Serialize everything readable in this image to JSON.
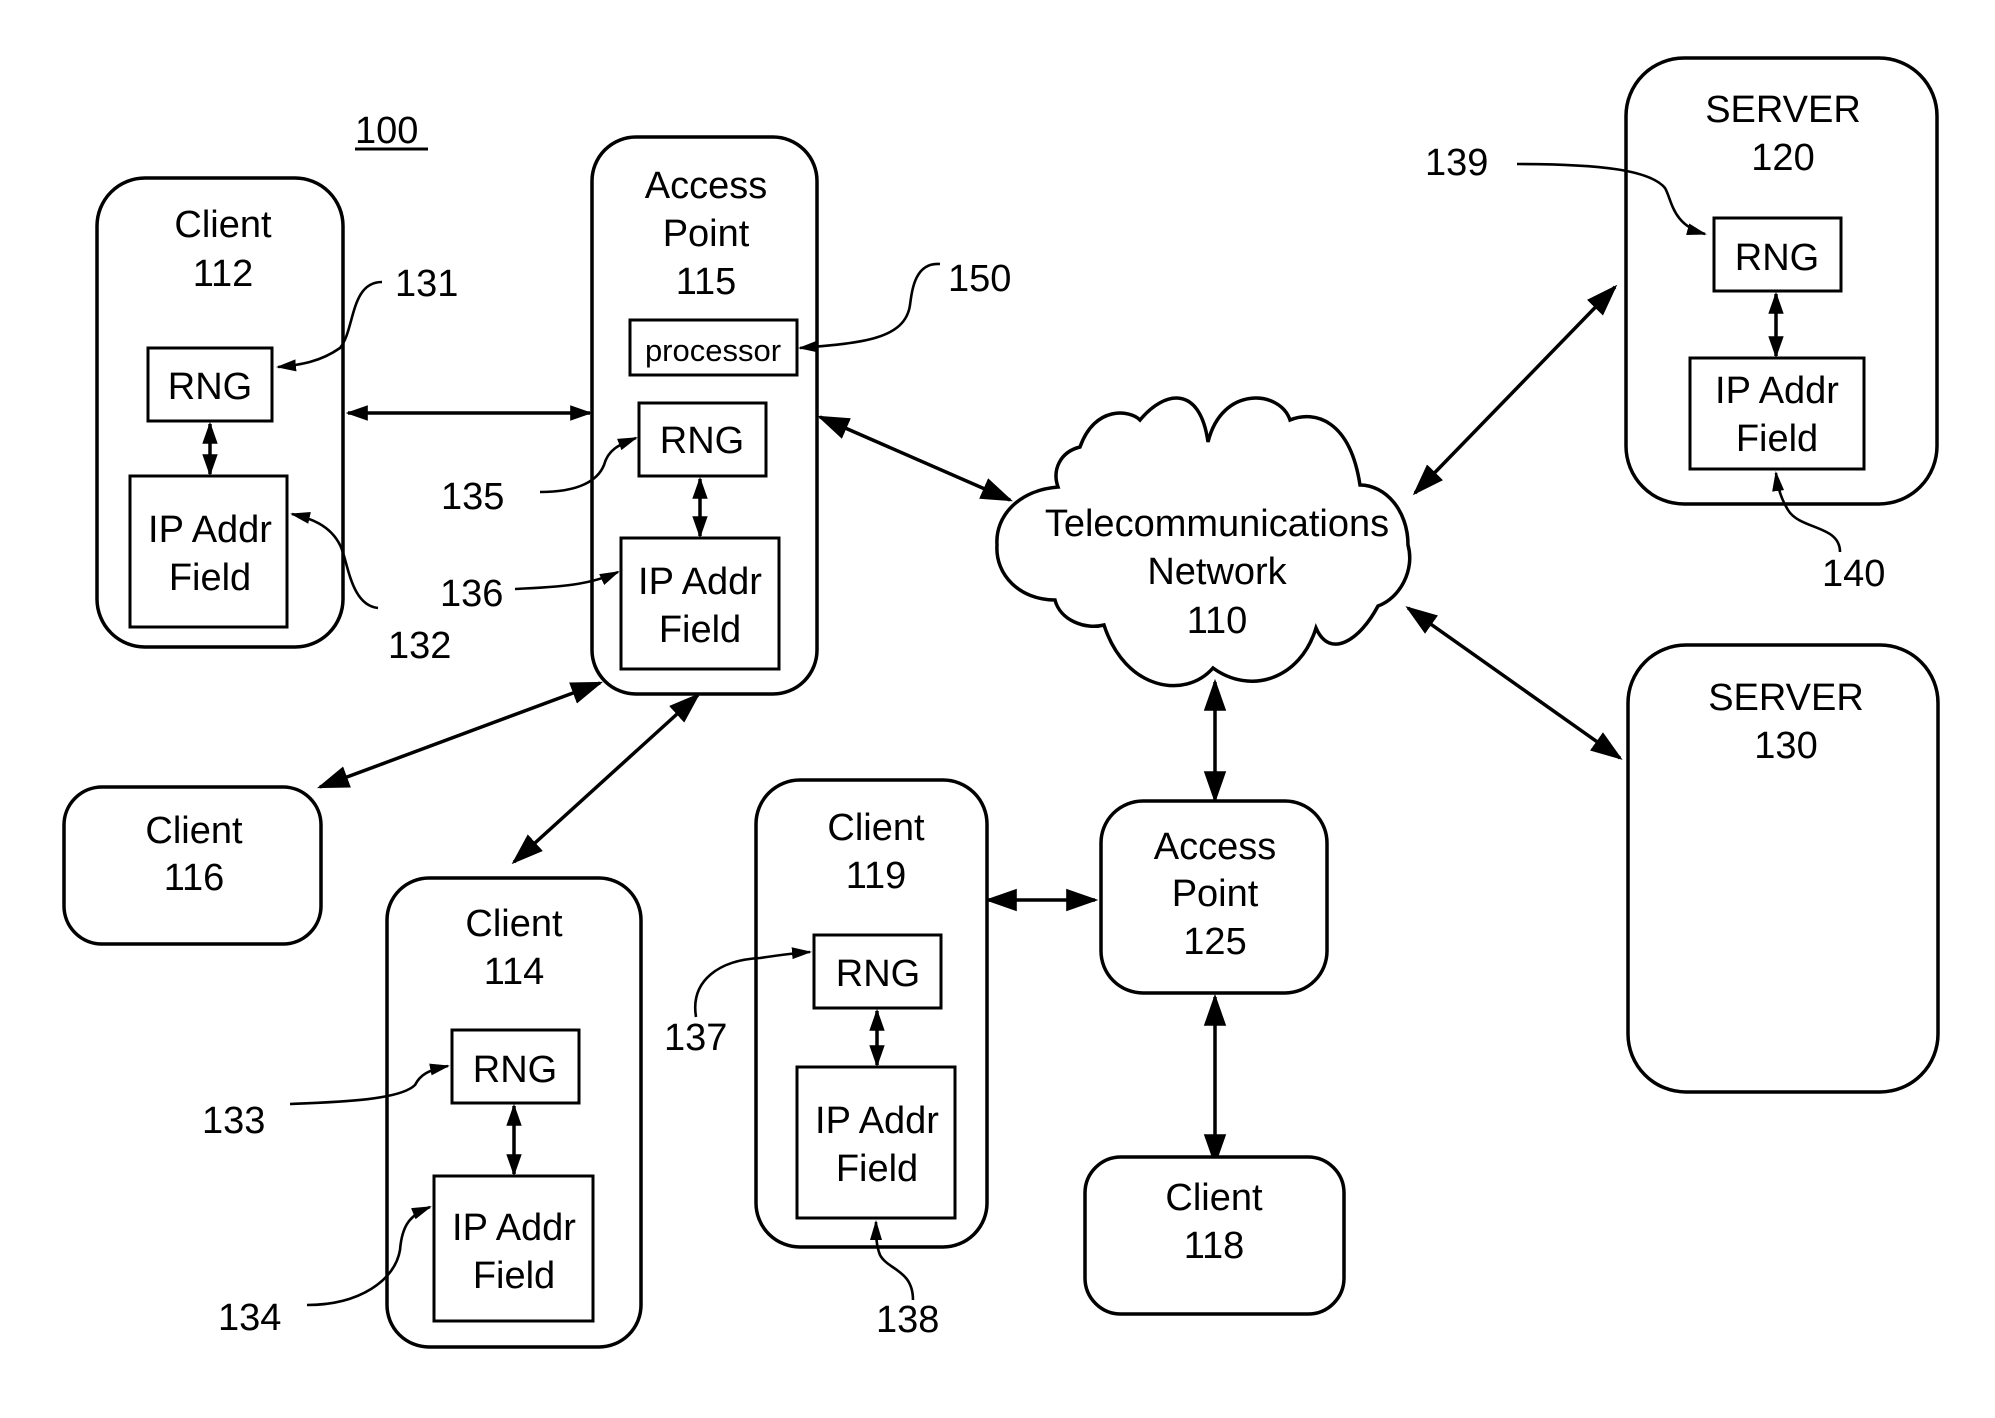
{
  "figure": {
    "number": "100"
  },
  "nodes": {
    "client112": {
      "title": "Client",
      "ref": "112",
      "rng": "RNG",
      "ip1": "IP Addr",
      "ip2": "Field"
    },
    "ap115": {
      "title1": "Access",
      "title2": "Point",
      "ref": "115",
      "processor": "processor",
      "rng": "RNG",
      "ip1": "IP Addr",
      "ip2": "Field"
    },
    "network110": {
      "title1": "Telecommunications",
      "title2": "Network",
      "ref": "110"
    },
    "server120": {
      "title": "SERVER",
      "ref": "120",
      "rng": "RNG",
      "ip1": "IP Addr",
      "ip2": "Field"
    },
    "server130": {
      "title": "SERVER",
      "ref": "130"
    },
    "client116": {
      "title": "Client",
      "ref": "116"
    },
    "client114": {
      "title": "Client",
      "ref": "114",
      "rng": "RNG",
      "ip1": "IP Addr",
      "ip2": "Field"
    },
    "client119": {
      "title": "Client",
      "ref": "119",
      "rng": "RNG",
      "ip1": "IP Addr",
      "ip2": "Field"
    },
    "ap125": {
      "title1": "Access",
      "title2": "Point",
      "ref": "125"
    },
    "client118": {
      "title": "Client",
      "ref": "118"
    }
  },
  "refs": {
    "r131": "131",
    "r132": "132",
    "r133": "133",
    "r134": "134",
    "r135": "135",
    "r136": "136",
    "r137": "137",
    "r138": "138",
    "r139": "139",
    "r140": "140",
    "r150": "150"
  }
}
